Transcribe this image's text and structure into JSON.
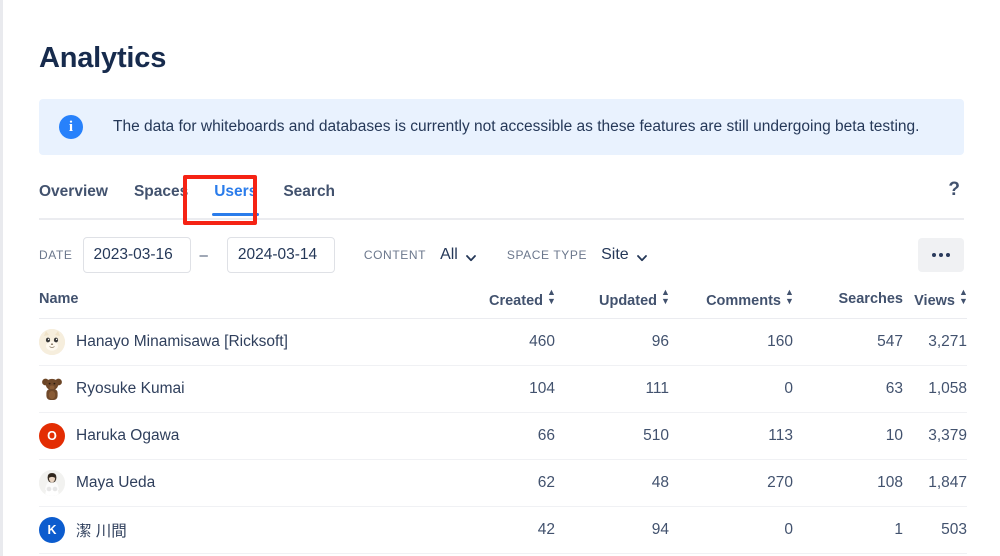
{
  "page": {
    "title": "Analytics"
  },
  "banner": {
    "icon": "info-icon",
    "text": "The data for whiteboards and databases is currently not accessible as these features are still undergoing beta testing.",
    "bg_color": "#e9f2fe",
    "icon_color": "#2781fb"
  },
  "tabs": {
    "items": [
      {
        "label": "Overview",
        "active": false
      },
      {
        "label": "Spaces",
        "active": false
      },
      {
        "label": "Users",
        "active": true
      },
      {
        "label": "Search",
        "active": false
      }
    ],
    "help_label": "?",
    "active_color": "#2a7ceb",
    "highlight_color": "#f52314"
  },
  "filters": {
    "date_label": "DATE",
    "date_from": "2023-03-16",
    "date_to": "2024-03-14",
    "date_separator": "–",
    "content_label": "CONTENT",
    "content_value": "All",
    "space_type_label": "SPACE TYPE",
    "space_type_value": "Site",
    "more_button": "more-options"
  },
  "table": {
    "columns": [
      {
        "label": "Name",
        "sortable": false,
        "align": "left"
      },
      {
        "label": "Created",
        "sortable": true,
        "align": "right"
      },
      {
        "label": "Updated",
        "sortable": true,
        "align": "right"
      },
      {
        "label": "Comments",
        "sortable": true,
        "align": "right"
      },
      {
        "label": "Searches",
        "sortable": false,
        "align": "right"
      },
      {
        "label": "Views",
        "sortable": true,
        "align": "right"
      }
    ],
    "rows": [
      {
        "name": "Hanayo Minamisawa [Ricksoft]",
        "avatar": {
          "type": "image",
          "kind": "cat-face",
          "bg": "#f3e7d2"
        },
        "created": "460",
        "updated": "96",
        "comments": "160",
        "searches": "547",
        "views": "3,271"
      },
      {
        "name": "Ryosuke Kumai",
        "avatar": {
          "type": "image",
          "kind": "bear-face",
          "bg": "#ffffff"
        },
        "created": "104",
        "updated": "111",
        "comments": "0",
        "searches": "63",
        "views": "1,058"
      },
      {
        "name": "Haruka Ogawa",
        "avatar": {
          "type": "initial",
          "initial": "O",
          "bg": "#e32d03"
        },
        "created": "66",
        "updated": "510",
        "comments": "113",
        "searches": "10",
        "views": "3,379"
      },
      {
        "name": "Maya Ueda",
        "avatar": {
          "type": "image",
          "kind": "person-photo",
          "bg": "#e8e8e8"
        },
        "created": "62",
        "updated": "48",
        "comments": "270",
        "searches": "108",
        "views": "1,847"
      },
      {
        "name": "潔 川間",
        "avatar": {
          "type": "initial",
          "initial": "K",
          "bg": "#0c5cce"
        },
        "created": "42",
        "updated": "94",
        "comments": "0",
        "searches": "1",
        "views": "503"
      }
    ]
  }
}
